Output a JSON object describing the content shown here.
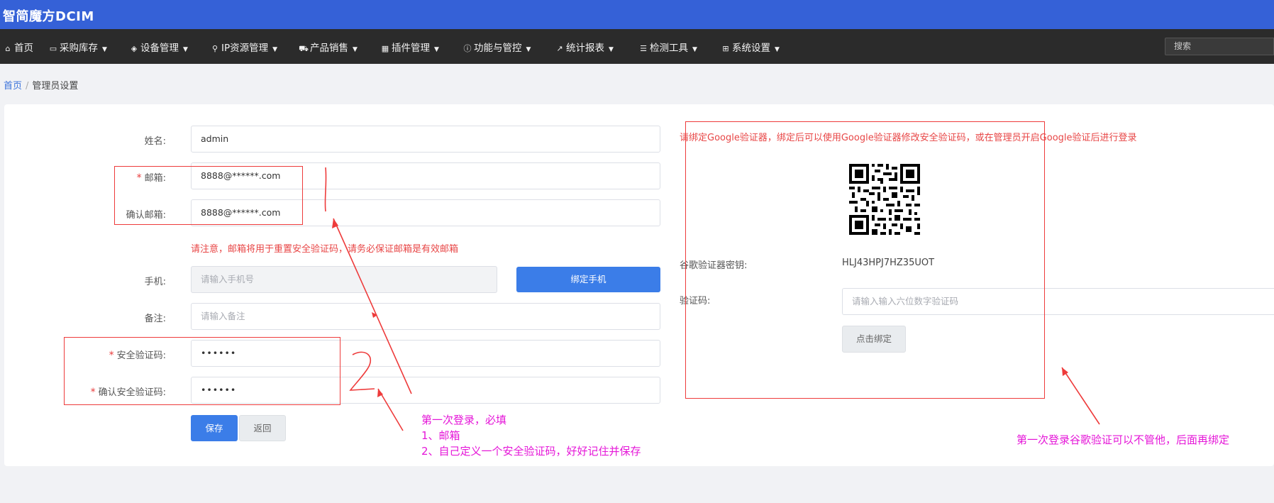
{
  "app": {
    "title": "智简魔方DCIM"
  },
  "nav": {
    "items": [
      {
        "label": "首页",
        "icon": "home-icon",
        "has_caret": false
      },
      {
        "label": "采购库存",
        "icon": "inbox-icon",
        "has_caret": true
      },
      {
        "label": "设备管理",
        "icon": "cube-icon",
        "has_caret": true
      },
      {
        "label": "IP资源管理",
        "icon": "map-marker-icon",
        "has_caret": true
      },
      {
        "label": "产品销售",
        "icon": "cart-icon",
        "has_caret": true
      },
      {
        "label": "插件管理",
        "icon": "grid-icon",
        "has_caret": true
      },
      {
        "label": "功能与管控",
        "icon": "info-icon",
        "has_caret": true
      },
      {
        "label": "统计报表",
        "icon": "line-chart-icon",
        "has_caret": true
      },
      {
        "label": "检测工具",
        "icon": "list-icon",
        "has_caret": true
      },
      {
        "label": "系统设置",
        "icon": "windows-icon",
        "has_caret": true
      }
    ],
    "search_placeholder": "搜索"
  },
  "breadcrumb": {
    "home": "首页",
    "separator": "/",
    "current": "管理员设置"
  },
  "form": {
    "name": {
      "label": "姓名:",
      "value": "admin"
    },
    "email": {
      "label": "邮箱:",
      "value": "8888@******.com",
      "required": "*"
    },
    "email_confirm": {
      "label": "确认邮箱:",
      "value": "8888@******.com"
    },
    "email_warning": "请注意，邮箱将用于重置安全验证码，请务必保证邮箱是有效邮箱",
    "phone": {
      "label": "手机:",
      "placeholder": "请输入手机号"
    },
    "bind_phone_button": "绑定手机",
    "remark": {
      "label": "备注:",
      "placeholder": "请输入备注"
    },
    "security_code": {
      "label": "安全验证码:",
      "value": "••••••",
      "required": "*"
    },
    "security_code_confirm": {
      "label": "确认安全验证码:",
      "value": "••••••",
      "required": "*"
    },
    "save_button": "保存",
    "back_button": "返回"
  },
  "google_auth": {
    "notice": "请绑定Google验证器，绑定后可以使用Google验证器修改安全验证码，或在管理员开启Google验证后进行登录",
    "secret_label": "谷歌验证器密钥:",
    "secret_value": "HLJ43HPJ7HZ35UOT",
    "code_label": "验证码:",
    "code_placeholder": "请输入输入六位数字验证码",
    "bind_button": "点击绑定"
  },
  "annotations": {
    "left_lines": [
      "第一次登录，必填",
      "1、邮箱",
      "2、自己定义一个安全验证码，好好记住并保存"
    ],
    "right_note": "第一次登录谷歌验证可以不管他，后面再绑定",
    "color": "#e516d8",
    "box_color": "#ee3b3b"
  },
  "colors": {
    "topbar": "#3561d7",
    "navbar": "#2b2b2b",
    "primary": "#3b7de8",
    "warning": "#e84646"
  }
}
